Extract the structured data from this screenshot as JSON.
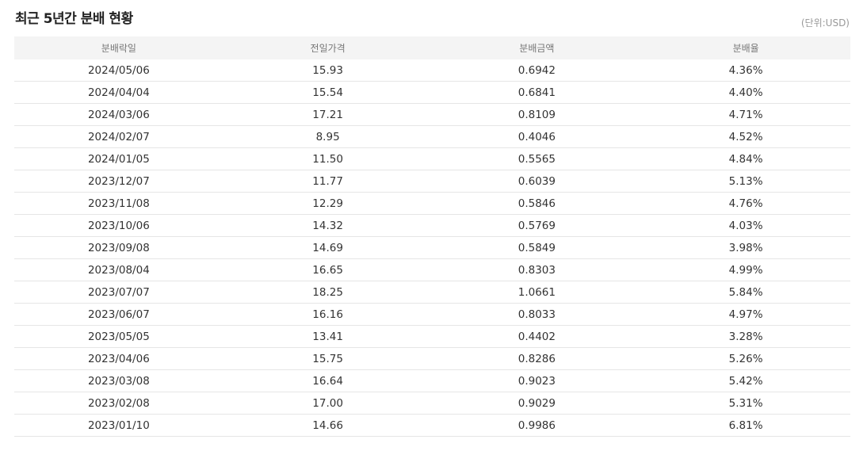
{
  "title": "최근 5년간 분배 현황",
  "unit": "(단위:USD)",
  "table": {
    "headers": [
      "분배락일",
      "전일가격",
      "분배금액",
      "분배율"
    ],
    "rows": [
      [
        "2024/05/06",
        "15.93",
        "0.6942",
        "4.36%"
      ],
      [
        "2024/04/04",
        "15.54",
        "0.6841",
        "4.40%"
      ],
      [
        "2024/03/06",
        "17.21",
        "0.8109",
        "4.71%"
      ],
      [
        "2024/02/07",
        "8.95",
        "0.4046",
        "4.52%"
      ],
      [
        "2024/01/05",
        "11.50",
        "0.5565",
        "4.84%"
      ],
      [
        "2023/12/07",
        "11.77",
        "0.6039",
        "5.13%"
      ],
      [
        "2023/11/08",
        "12.29",
        "0.5846",
        "4.76%"
      ],
      [
        "2023/10/06",
        "14.32",
        "0.5769",
        "4.03%"
      ],
      [
        "2023/09/08",
        "14.69",
        "0.5849",
        "3.98%"
      ],
      [
        "2023/08/04",
        "16.65",
        "0.8303",
        "4.99%"
      ],
      [
        "2023/07/07",
        "18.25",
        "1.0661",
        "5.84%"
      ],
      [
        "2023/06/07",
        "16.16",
        "0.8033",
        "4.97%"
      ],
      [
        "2023/05/05",
        "13.41",
        "0.4402",
        "3.28%"
      ],
      [
        "2023/04/06",
        "15.75",
        "0.8286",
        "5.26%"
      ],
      [
        "2023/03/08",
        "16.64",
        "0.9023",
        "5.42%"
      ],
      [
        "2023/02/08",
        "17.00",
        "0.9029",
        "5.31%"
      ],
      [
        "2023/01/10",
        "14.66",
        "0.9986",
        "6.81%"
      ]
    ]
  }
}
